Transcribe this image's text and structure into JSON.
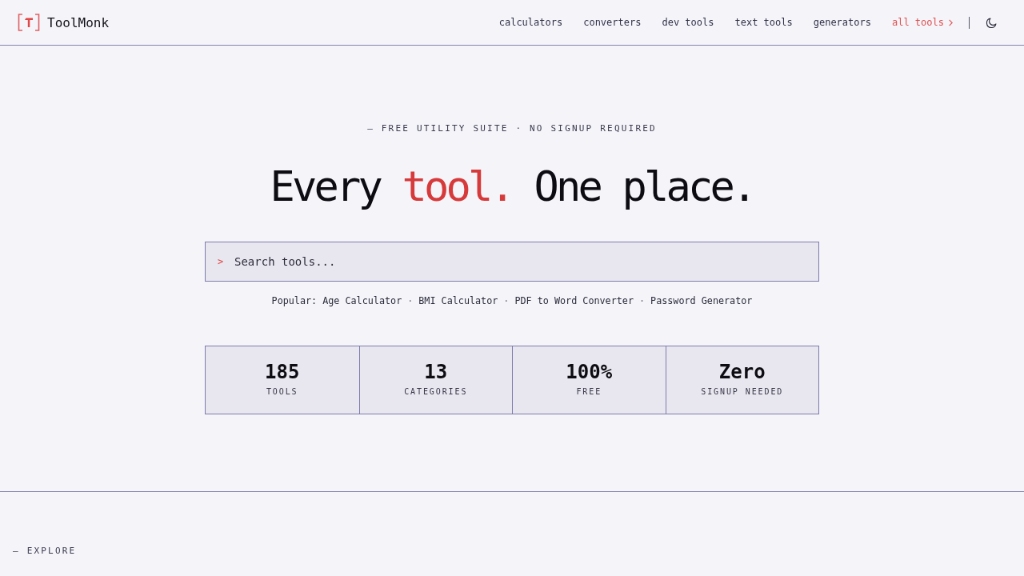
{
  "header": {
    "brand": "ToolMonk",
    "nav": [
      {
        "label": "calculators",
        "highlighted": false
      },
      {
        "label": "converters",
        "highlighted": false
      },
      {
        "label": "dev tools",
        "highlighted": false
      },
      {
        "label": "text tools",
        "highlighted": false
      },
      {
        "label": "generators",
        "highlighted": false
      },
      {
        "label": "all tools",
        "highlighted": true
      }
    ]
  },
  "hero": {
    "eyebrow": "— FREE UTILITY SUITE · NO SIGNUP REQUIRED",
    "headline": [
      {
        "text": "Every ",
        "accent": false
      },
      {
        "text": "tool.",
        "accent": true
      },
      {
        "text": " One place.",
        "accent": false
      }
    ],
    "search": {
      "prompt": ">",
      "placeholder": "Search tools..."
    },
    "popular": {
      "label": "Popular:",
      "items": [
        {
          "kind": "link",
          "text": "Age Calculator"
        },
        {
          "kind": "separator",
          "text": "·"
        },
        {
          "kind": "link",
          "text": "BMI Calculator"
        },
        {
          "kind": "separator",
          "text": "·"
        },
        {
          "kind": "link",
          "text": "PDF to Word Converter"
        },
        {
          "kind": "separator",
          "text": "·"
        },
        {
          "kind": "link",
          "text": "Password Generator"
        }
      ]
    },
    "stats": [
      {
        "value": "185",
        "label": "TOOLS"
      },
      {
        "value": "13",
        "label": "CATEGORIES"
      },
      {
        "value": "100%",
        "label": "FREE"
      },
      {
        "value": "Zero",
        "label": "SIGNUP NEEDED"
      }
    ]
  },
  "explore": {
    "eyebrow": "— EXPLORE"
  }
}
